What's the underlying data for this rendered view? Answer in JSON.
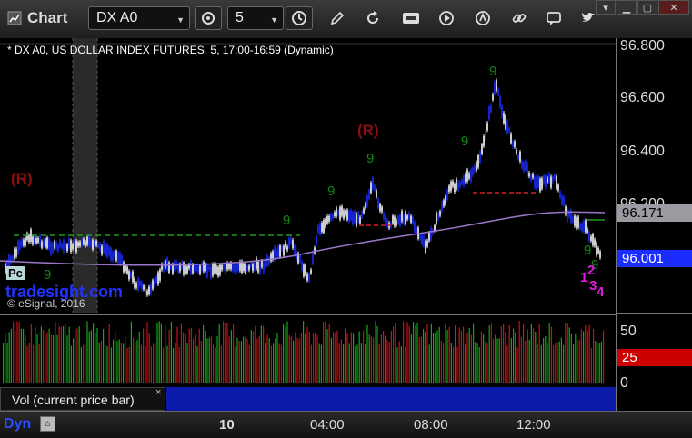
{
  "toolbar": {
    "app_title": "Chart",
    "symbol": "DX A0",
    "interval": "5"
  },
  "chart": {
    "title": "* DX A0, US DOLLAR INDEX FUTURES, 5, 17:00-16:59 (Dynamic)",
    "watermark": "tradesight.com",
    "copyright": "© eSignal, 2016",
    "r_label_left": "(R)",
    "r_label_mid": "(R)",
    "count_labels": [
      "1",
      "2",
      "3",
      "4"
    ],
    "tdst_numbers": [
      "9",
      "9",
      "9",
      "9",
      "9",
      "9",
      "9",
      "9"
    ],
    "pc_label": "Pc",
    "price_axis": [
      "96.800",
      "96.600",
      "96.400",
      "96.200",
      "96.000"
    ],
    "current_price_tag": "96.001",
    "ma_price_tag": "96.171",
    "volume_axis": [
      "50",
      "25",
      "0"
    ],
    "volume_tag": "25",
    "volume_study_label": "Vol (current price bar)",
    "volume_close_x": "×",
    "time_axis": [
      "10",
      "04:00",
      "08:00",
      "12:00"
    ],
    "dyn_label": "Dyn",
    "dyn_icon": "lock-icon",
    "colors": {
      "up_candle": "#1a2cff",
      "down_candle": "#ffffff",
      "ma_line": "#9a77c9",
      "green_dash": "#1c9b1c",
      "red_dash": "#d22020",
      "price_tag_bg": "#1a2cff",
      "ma_tag_bg": "#9a9aa0",
      "volume_tag_bg": "#cc0000",
      "vol_green": "#11aa11",
      "vol_red": "#cc1111",
      "magenta": "#e21ae2",
      "r_label": "#8b1010",
      "setup_green": "#118811"
    }
  }
}
